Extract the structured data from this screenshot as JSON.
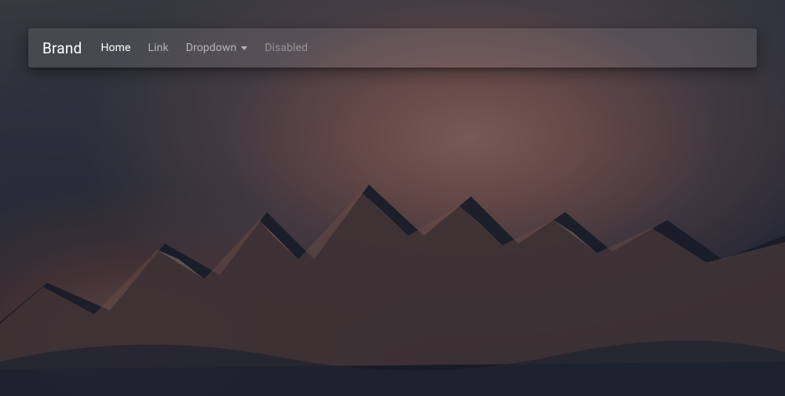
{
  "navbar": {
    "brand": "Brand",
    "items": [
      {
        "label": "Home",
        "state": "active",
        "interactable": true
      },
      {
        "label": "Link",
        "state": "normal",
        "interactable": true
      },
      {
        "label": "Dropdown",
        "state": "normal",
        "interactable": true,
        "has_caret": true
      },
      {
        "label": "Disabled",
        "state": "disabled",
        "interactable": false
      }
    ]
  },
  "icons": {
    "caret_down": "caret-down-icon"
  },
  "background": {
    "description": "Mountain peaks at sunset, snow-capped, wrapped in orange-tinted clouds, dim moody sky"
  }
}
